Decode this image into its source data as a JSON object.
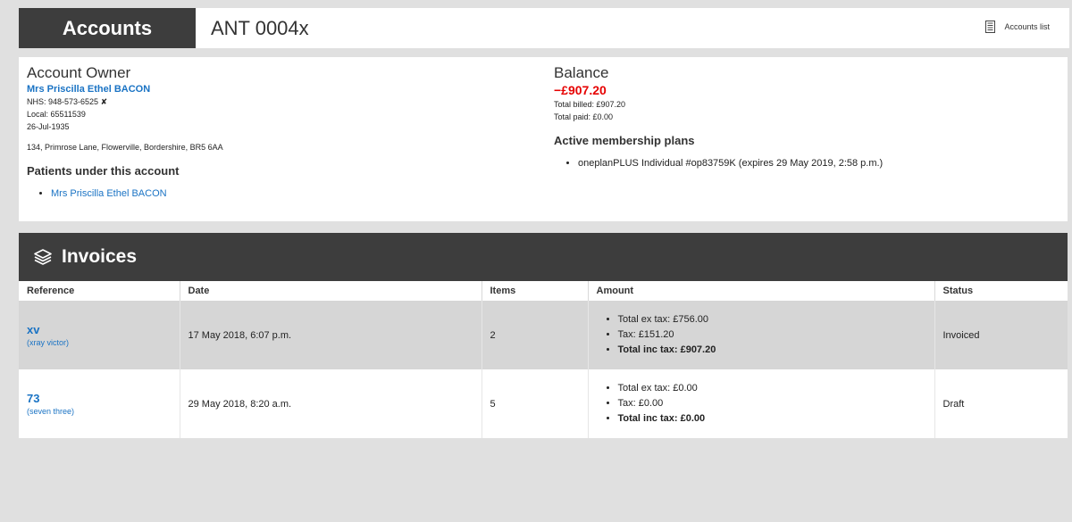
{
  "header": {
    "section": "Accounts",
    "record_id": "ANT 0004x",
    "accounts_list_label": "Accounts list"
  },
  "owner": {
    "title": "Account Owner",
    "name": "Mrs Priscilla Ethel BACON",
    "nhs": "NHS: 948-573-6525",
    "nhs_flag": "✘",
    "local": "Local: 65511539",
    "dob": "26-Jul-1935",
    "address": "134, Primrose Lane, Flowerville, Bordershire, BR5 6AA"
  },
  "patients": {
    "title": "Patients under this account",
    "items": [
      "Mrs Priscilla Ethel BACON"
    ]
  },
  "balance": {
    "title": "Balance",
    "amount": "−£907.20",
    "total_billed": "Total billed: £907.20",
    "total_paid": "Total paid: £0.00",
    "amount_color": "#e60000"
  },
  "plans": {
    "title": "Active membership plans",
    "items": [
      "oneplanPLUS Individual #op83759K (expires 29 May 2019, 2:58 p.m.)"
    ]
  },
  "invoices": {
    "title": "Invoices",
    "columns": [
      "Reference",
      "Date",
      "Items",
      "Amount",
      "Status"
    ],
    "rows": [
      {
        "ref": "xv",
        "ref_sub": "(xray victor)",
        "date": "17 May 2018, 6:07 p.m.",
        "items": "2",
        "ex_tax": "Total ex tax: £756.00",
        "tax": "Tax: £151.20",
        "inc_tax": "Total inc tax: £907.20",
        "status": "Invoiced"
      },
      {
        "ref": "73",
        "ref_sub": "(seven three)",
        "date": "29 May 2018, 8:20 a.m.",
        "items": "5",
        "ex_tax": "Total ex tax: £0.00",
        "tax": "Tax: £0.00",
        "inc_tax": "Total inc tax: £0.00",
        "status": "Draft"
      }
    ]
  },
  "icons": {
    "accounts_list": "document-list-icon",
    "invoices": "layers-icon"
  }
}
